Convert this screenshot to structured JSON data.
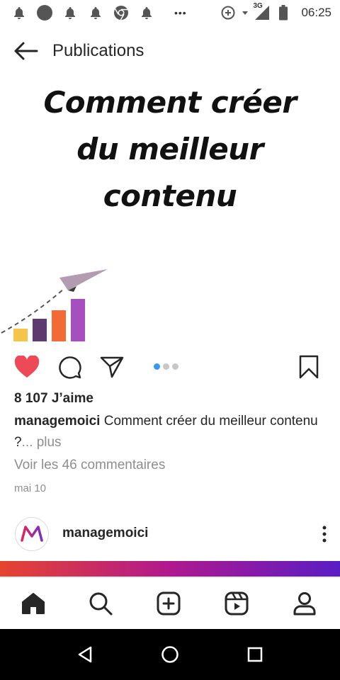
{
  "status_bar": {
    "time": "06:25",
    "network": "3G",
    "more_indicator": "•••",
    "left_icons": [
      "notification-bell-icon",
      "circle-avatar-icon",
      "notification-bell-icon",
      "notification-bell-icon",
      "chrome-icon",
      "notification-bell-icon"
    ],
    "right_icons": [
      "data-saver-icon",
      "wifi-arrow-icon",
      "signal-icon",
      "battery-icon"
    ]
  },
  "header": {
    "title": "Publications"
  },
  "post": {
    "image_headline": [
      "Comment créer",
      "du meilleur",
      "contenu"
    ],
    "art_colors": {
      "bar1": "#f7c44a",
      "bar2": "#5e3a6e",
      "bar3": "#f26b36",
      "bar4": "#a84fbf",
      "plane": "#b39bb0"
    },
    "likes": "8 107 J’aime",
    "caption_user": "managemoici",
    "caption_text": "Comment créer du meilleur contenu ?",
    "caption_more": "... plus",
    "comments_link": "Voir les 46 commentaires",
    "date": "mai 10",
    "carousel_count": 3,
    "carousel_active": 1,
    "like_color": "#ed4956"
  },
  "next_post": {
    "username": "managemoici"
  },
  "bottom_nav": {
    "items": [
      "home-icon",
      "search-icon",
      "create-post-icon",
      "reels-icon",
      "profile-icon"
    ]
  },
  "system_nav": {
    "items": [
      "back-icon",
      "home-circle-icon",
      "recents-icon"
    ]
  }
}
